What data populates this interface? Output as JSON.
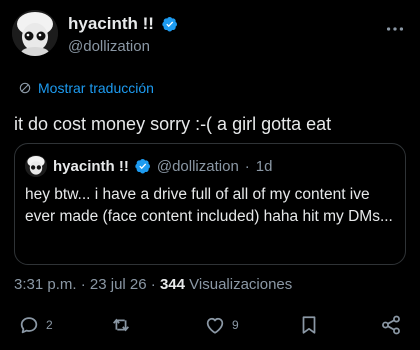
{
  "author": {
    "display_name": "hyacinth !!",
    "handle": "@dollization"
  },
  "translate": {
    "label": "Mostrar traducción"
  },
  "tweet": {
    "text": "it do cost money sorry :-( a girl gotta eat"
  },
  "quote": {
    "display_name": "hyacinth !!",
    "handle": "@dollization",
    "sep": "·",
    "age": "1d",
    "text": "hey btw... i have a drive full of all of my content ive ever made (face content included) haha hit my DMs..."
  },
  "meta": {
    "time": "3:31 p.m.",
    "sep1": "·",
    "date": "23 jul 26",
    "sep2": "·",
    "views_count": "344",
    "views_label": "Visualizaciones"
  },
  "actions": {
    "replies": "2",
    "likes": "9"
  },
  "colors": {
    "background": "#000000",
    "text": "#e7e9ea",
    "muted": "#8b98a5",
    "accent": "#1d9bf0",
    "border": "#2f3336"
  },
  "icons": [
    "verified-badge-icon",
    "more-options-icon",
    "translate-icon",
    "reply-icon",
    "repost-icon",
    "like-icon",
    "bookmark-icon",
    "share-icon"
  ]
}
